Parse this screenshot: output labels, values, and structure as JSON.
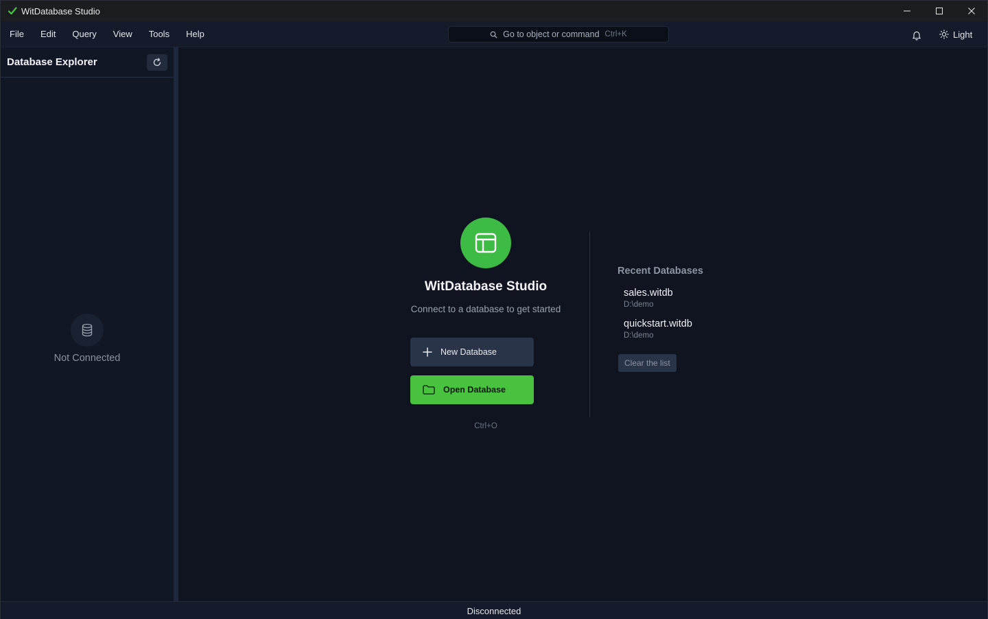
{
  "window": {
    "title": "WitDatabase Studio"
  },
  "menu": {
    "items": [
      "File",
      "Edit",
      "Query",
      "View",
      "Tools",
      "Help"
    ]
  },
  "command_search": {
    "placeholder": "Go to object or command",
    "shortcut": "Ctrl+K"
  },
  "theme_toggle": {
    "label": "Light",
    "icon": "sun-icon"
  },
  "notifications": {
    "icon": "bell-icon"
  },
  "sidebar": {
    "title": "Database Explorer",
    "refresh_icon": "refresh-icon",
    "empty_icon": "database-icon",
    "empty_text": "Not Connected"
  },
  "welcome": {
    "logo_icon": "layout-icon",
    "title": "WitDatabase Studio",
    "subtitle": "Connect to a database to get started",
    "new_button": "New Database",
    "open_button": "Open Database",
    "open_shortcut": "Ctrl+O"
  },
  "recent": {
    "title": "Recent Databases",
    "items": [
      {
        "name": "sales.witdb",
        "path": "D:\\demo"
      },
      {
        "name": "quickstart.witdb",
        "path": "D:\\demo"
      }
    ],
    "clear_label": "Clear the list"
  },
  "statusbar": {
    "text": "Disconnected"
  },
  "colors": {
    "accent": "#48c23f",
    "background": "#0f1420",
    "sidebar": "#111725",
    "menubar": "#151b2a"
  }
}
